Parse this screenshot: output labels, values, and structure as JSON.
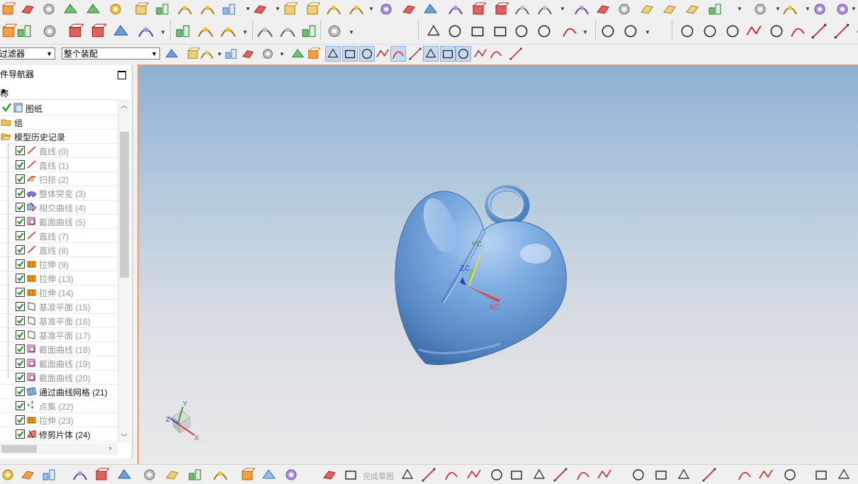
{
  "toolbar_row3": {
    "filter_label": "过滤器",
    "assembly_label": "整个装配"
  },
  "navigator": {
    "title": "件导航器",
    "column_header": "称",
    "items": [
      {
        "label": "图纸",
        "icon": "drawing-sheet-icon",
        "checked": true,
        "dim": false,
        "level": 0
      },
      {
        "label": "组",
        "icon": "folder-icon",
        "checked": false,
        "dim": false,
        "level": 0
      },
      {
        "label": "模型历史记录",
        "icon": "folder-open-icon",
        "checked": false,
        "dim": false,
        "level": 0
      },
      {
        "label": "直线 (0)",
        "icon": "line-icon",
        "checked": true,
        "dim": true,
        "level": 1
      },
      {
        "label": "直线 (1)",
        "icon": "line-icon",
        "checked": true,
        "dim": true,
        "level": 1
      },
      {
        "label": "扫掠 (2)",
        "icon": "sweep-icon",
        "checked": true,
        "dim": true,
        "level": 1
      },
      {
        "label": "整体突变 (3)",
        "icon": "global-shaping-icon",
        "checked": true,
        "dim": true,
        "level": 1
      },
      {
        "label": "相交曲线 (4)",
        "icon": "intersection-curve-icon",
        "checked": true,
        "dim": true,
        "level": 1
      },
      {
        "label": "截面曲线 (5)",
        "icon": "section-curve-icon",
        "checked": true,
        "dim": true,
        "level": 1
      },
      {
        "label": "直线 (7)",
        "icon": "line-icon",
        "checked": true,
        "dim": true,
        "level": 1
      },
      {
        "label": "直线 (8)",
        "icon": "line-icon",
        "checked": true,
        "dim": true,
        "level": 1
      },
      {
        "label": "拉伸 (9)",
        "icon": "extrude-icon",
        "checked": true,
        "dim": true,
        "level": 1
      },
      {
        "label": "拉伸 (13)",
        "icon": "extrude-icon",
        "checked": true,
        "dim": true,
        "level": 1
      },
      {
        "label": "拉伸 (14)",
        "icon": "extrude-icon",
        "checked": true,
        "dim": true,
        "level": 1
      },
      {
        "label": "基准平面 (15)",
        "icon": "datum-plane-icon",
        "checked": true,
        "dim": true,
        "level": 1
      },
      {
        "label": "基准平面 (16)",
        "icon": "datum-plane-icon",
        "checked": true,
        "dim": true,
        "level": 1
      },
      {
        "label": "基准平面 (17)",
        "icon": "datum-plane-icon",
        "checked": true,
        "dim": true,
        "level": 1
      },
      {
        "label": "截面曲线 (18)",
        "icon": "section-curve-icon",
        "checked": true,
        "dim": true,
        "level": 1
      },
      {
        "label": "截面曲线 (19)",
        "icon": "section-curve-icon",
        "checked": true,
        "dim": true,
        "level": 1
      },
      {
        "label": "截面曲线 (20)",
        "icon": "section-curve-icon",
        "checked": true,
        "dim": true,
        "level": 1
      },
      {
        "label": "通过曲线网格 (21)",
        "icon": "curve-mesh-icon",
        "checked": true,
        "dim": false,
        "level": 1
      },
      {
        "label": "点集 (22)",
        "icon": "point-set-icon",
        "checked": true,
        "dim": true,
        "level": 1
      },
      {
        "label": "拉伸 (23)",
        "icon": "extrude-icon",
        "checked": true,
        "dim": true,
        "level": 1
      },
      {
        "label": "修剪片体 (24)",
        "icon": "trim-sheet-icon",
        "checked": true,
        "dim": false,
        "level": 1
      }
    ]
  },
  "viewport": {
    "wcs_labels": {
      "x": "XC",
      "y": "YC",
      "z": "ZC"
    },
    "triad_labels": {
      "x": "X",
      "y": "Y",
      "z": "Z"
    },
    "colors": {
      "accent_border": "#f19a5e",
      "part": "#6f9fd6",
      "x_axis": "#e33b3b",
      "y_axis": "#3a9a3a",
      "z_axis": "#2346c8"
    }
  },
  "bottom_bar": {
    "finish_sketch_label": "完成草图"
  }
}
